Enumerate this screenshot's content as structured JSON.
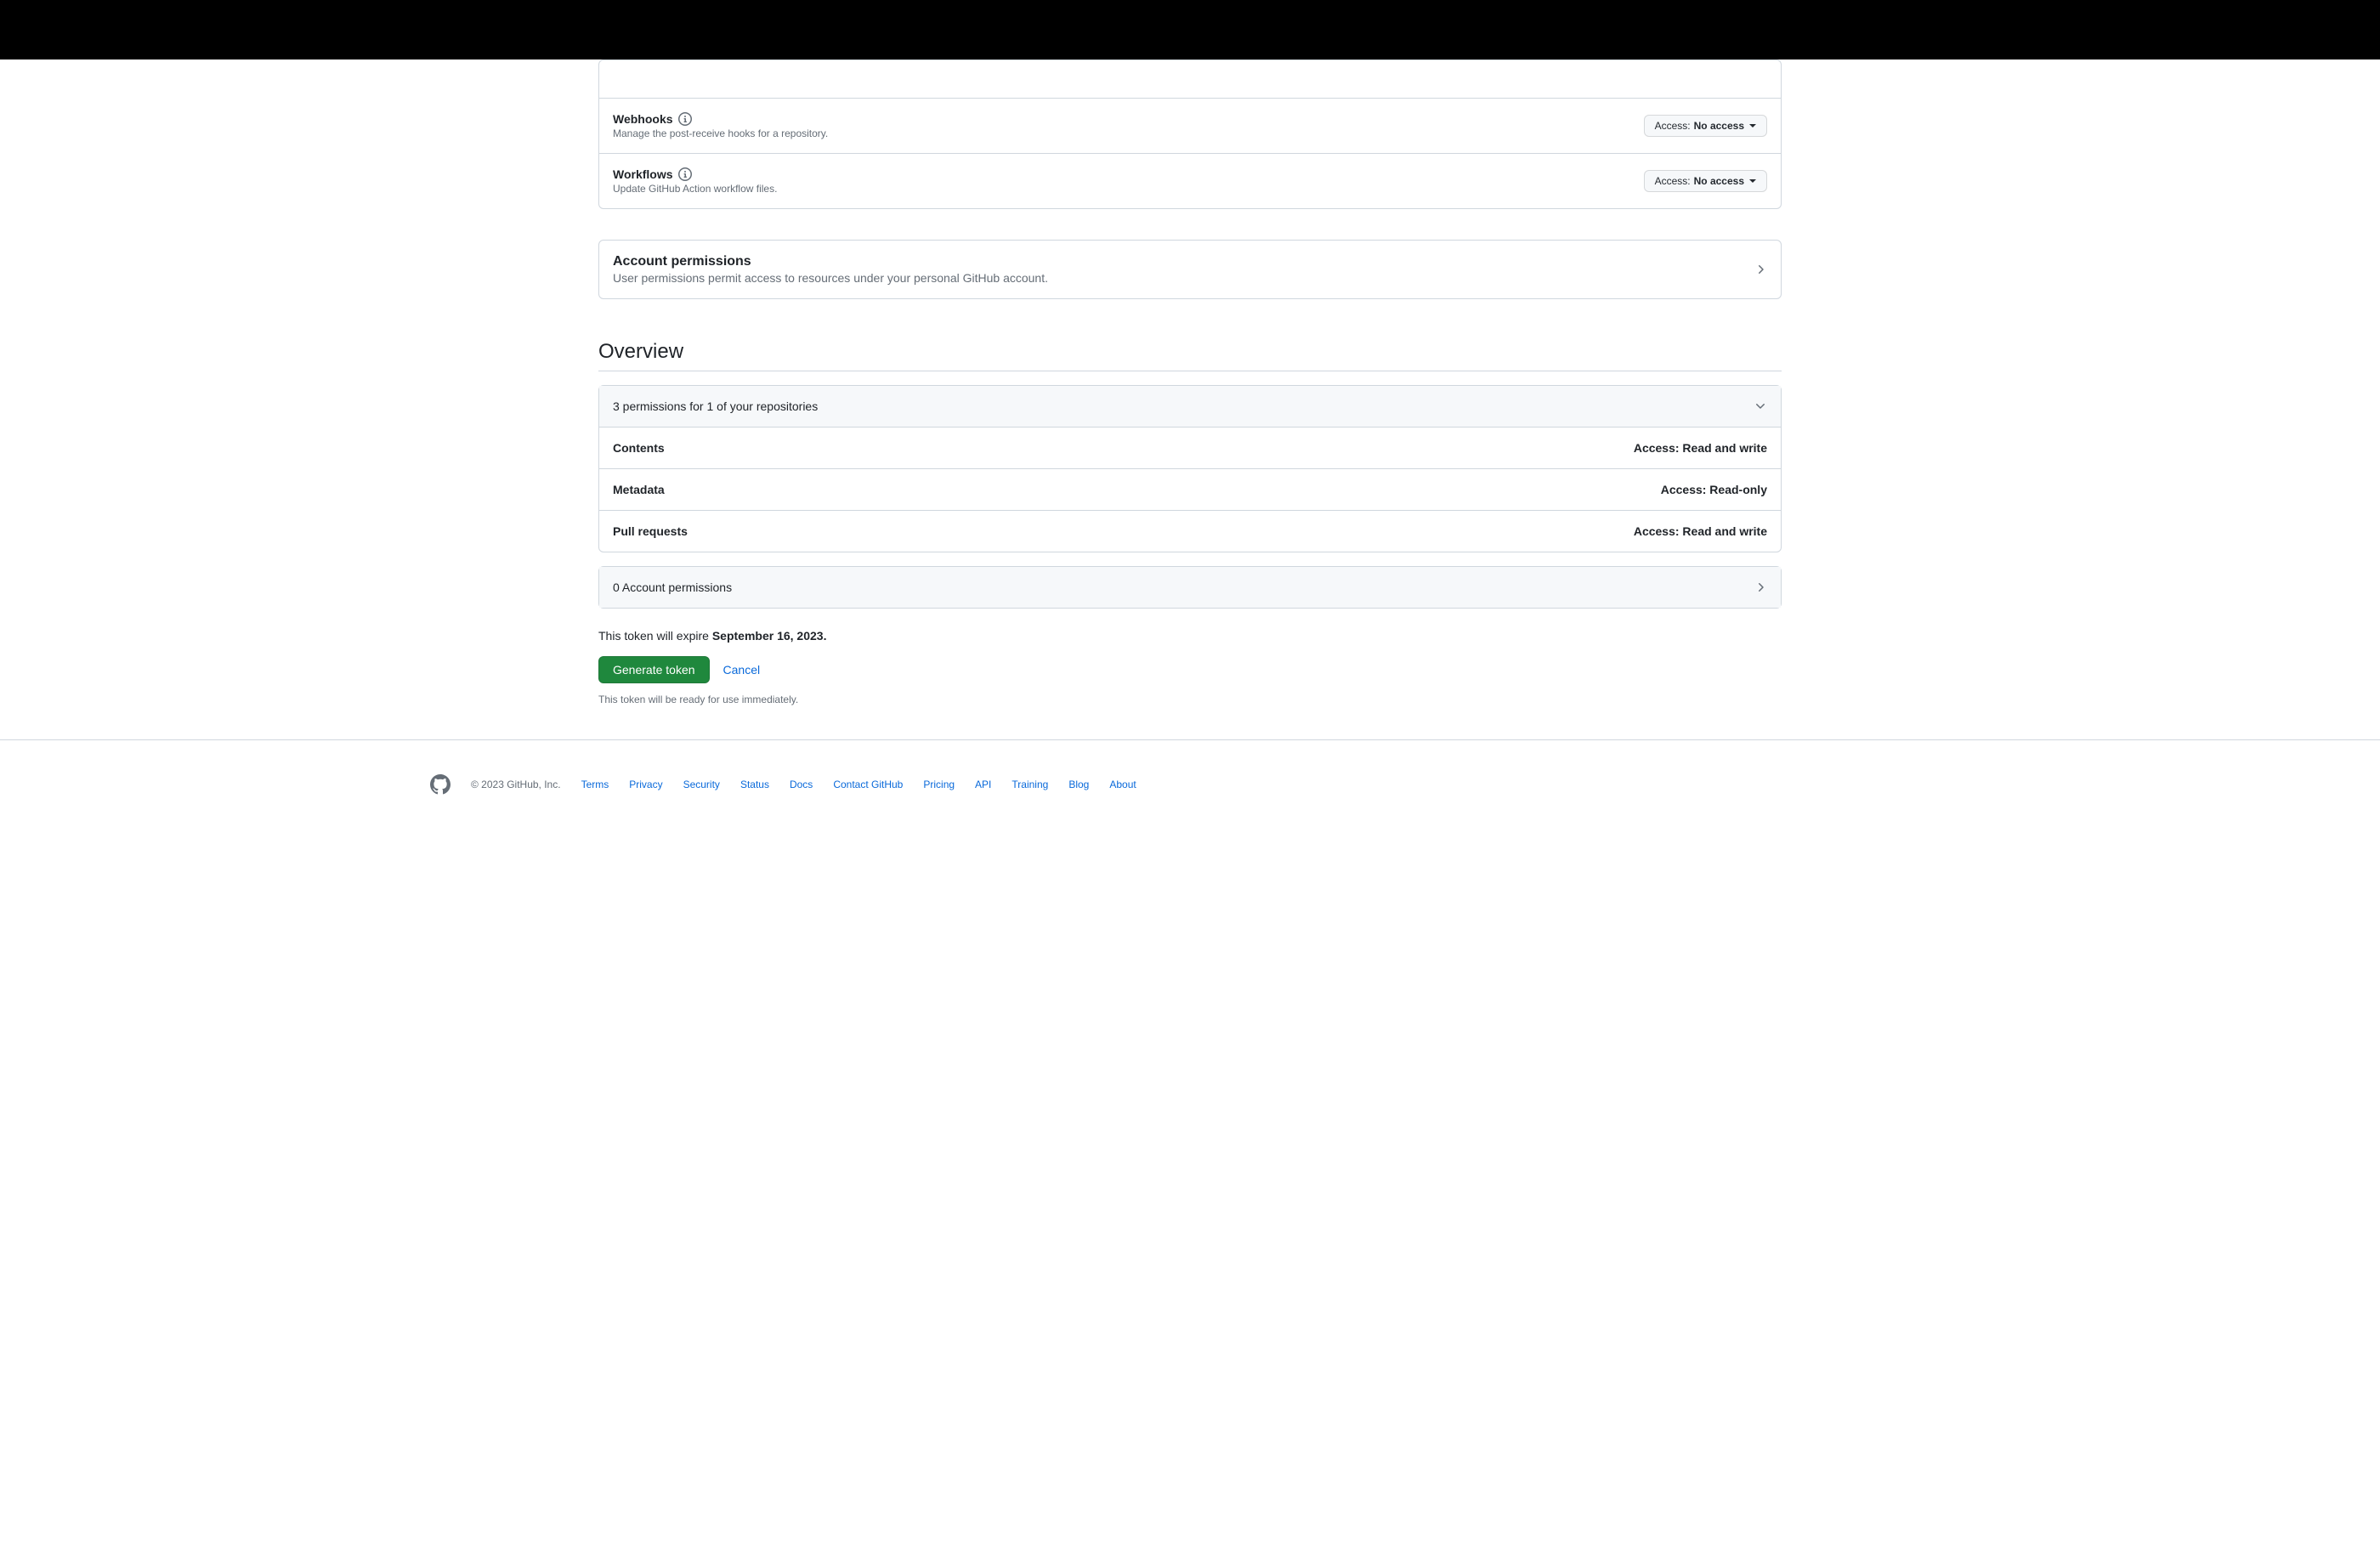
{
  "permissions": {
    "webhooks": {
      "title": "Webhooks",
      "desc": "Manage the post-receive hooks for a repository.",
      "access_label": "Access:",
      "access_value": "No access"
    },
    "workflows": {
      "title": "Workflows",
      "desc": "Update GitHub Action workflow files.",
      "access_label": "Access:",
      "access_value": "No access"
    }
  },
  "account_section": {
    "title": "Account permissions",
    "desc": "User permissions permit access to resources under your personal GitHub account."
  },
  "overview": {
    "heading": "Overview",
    "repo_perms_header": "3 permissions for 1 of your repositories",
    "items": [
      {
        "name": "Contents",
        "access": "Access: Read and write"
      },
      {
        "name": "Metadata",
        "access": "Access: Read-only"
      },
      {
        "name": "Pull requests",
        "access": "Access: Read and write"
      }
    ],
    "account_perms_header": "0 Account permissions"
  },
  "expire": {
    "prefix": "This token will expire ",
    "date": "September 16, 2023."
  },
  "actions": {
    "generate": "Generate token",
    "cancel": "Cancel",
    "note": "This token will be ready for use immediately."
  },
  "footer": {
    "copyright": "© 2023 GitHub, Inc.",
    "links": [
      "Terms",
      "Privacy",
      "Security",
      "Status",
      "Docs",
      "Contact GitHub",
      "Pricing",
      "API",
      "Training",
      "Blog",
      "About"
    ]
  }
}
